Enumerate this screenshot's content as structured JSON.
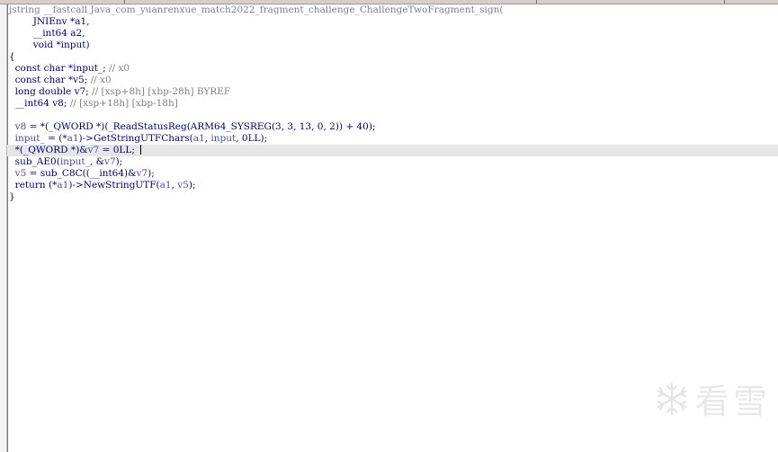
{
  "code_lines": [
    {
      "parts": [
        [
          "cm",
          "jstring __fastcall Java_com_yuanrenxue_match2022_fragment_challenge_ChallengeTwoFragment_sign("
        ]
      ]
    },
    {
      "parts": [
        [
          "pl",
          "        JNIEnv *a1,"
        ]
      ]
    },
    {
      "parts": [
        [
          "pl",
          "        __int64 a2,"
        ]
      ]
    },
    {
      "parts": [
        [
          "pl",
          "        void *input)"
        ]
      ]
    },
    {
      "parts": [
        [
          "pl",
          "{"
        ]
      ]
    },
    {
      "parts": [
        [
          "pl",
          "  const char *input_; "
        ],
        [
          "cm",
          "// x0"
        ]
      ]
    },
    {
      "parts": [
        [
          "pl",
          "  const char *v5; "
        ],
        [
          "cm",
          "// x0"
        ]
      ]
    },
    {
      "parts": [
        [
          "pl",
          "  long double v7; "
        ],
        [
          "cm",
          "// [xsp+8h] [xbp-28h] BYREF"
        ]
      ]
    },
    {
      "parts": [
        [
          "pl",
          "  __int64 v8; "
        ],
        [
          "cm",
          "// [xsp+18h] [xbp-18h]"
        ]
      ]
    },
    {
      "parts": [
        [
          "pl",
          ""
        ]
      ]
    },
    {
      "parts": [
        [
          "va",
          "  v8"
        ],
        [
          "pl",
          " = *(_QWORD *)(_ReadStatusReg(ARM64_SYSREG(3, 3, 13, 0, 2)) + 40);"
        ]
      ]
    },
    {
      "parts": [
        [
          "va",
          "  input_"
        ],
        [
          "pl",
          " = (*"
        ],
        [
          "va",
          "a1"
        ],
        [
          "pl",
          ")->GetStringUTFChars("
        ],
        [
          "va",
          "a1"
        ],
        [
          "pl",
          ", "
        ],
        [
          "va",
          "input"
        ],
        [
          "pl",
          ", 0LL);"
        ]
      ]
    },
    {
      "parts": [
        [
          "pl",
          "  *(_QWORD *)&"
        ],
        [
          "va",
          "v7"
        ],
        [
          "pl",
          " = 0LL;"
        ]
      ],
      "current": true
    },
    {
      "parts": [
        [
          "pl",
          "  sub_AE0("
        ],
        [
          "va",
          "input_"
        ],
        [
          "pl",
          ", &"
        ],
        [
          "va",
          "v7"
        ],
        [
          "pl",
          ");"
        ]
      ]
    },
    {
      "parts": [
        [
          "va",
          "  v5"
        ],
        [
          "pl",
          " = sub_C8C((__int64)&"
        ],
        [
          "va",
          "v7"
        ],
        [
          "pl",
          ");"
        ]
      ]
    },
    {
      "parts": [
        [
          "pl",
          "  return (*"
        ],
        [
          "va",
          "a1"
        ],
        [
          "pl",
          ")->NewStringUTF("
        ],
        [
          "va",
          "a1"
        ],
        [
          "pl",
          ", "
        ],
        [
          "va",
          "v5"
        ],
        [
          "pl",
          ");"
        ]
      ]
    },
    {
      "parts": [
        [
          "pl",
          "}"
        ]
      ]
    }
  ],
  "watermark": {
    "text": "看雪",
    "icon": "snowflake-icon"
  }
}
